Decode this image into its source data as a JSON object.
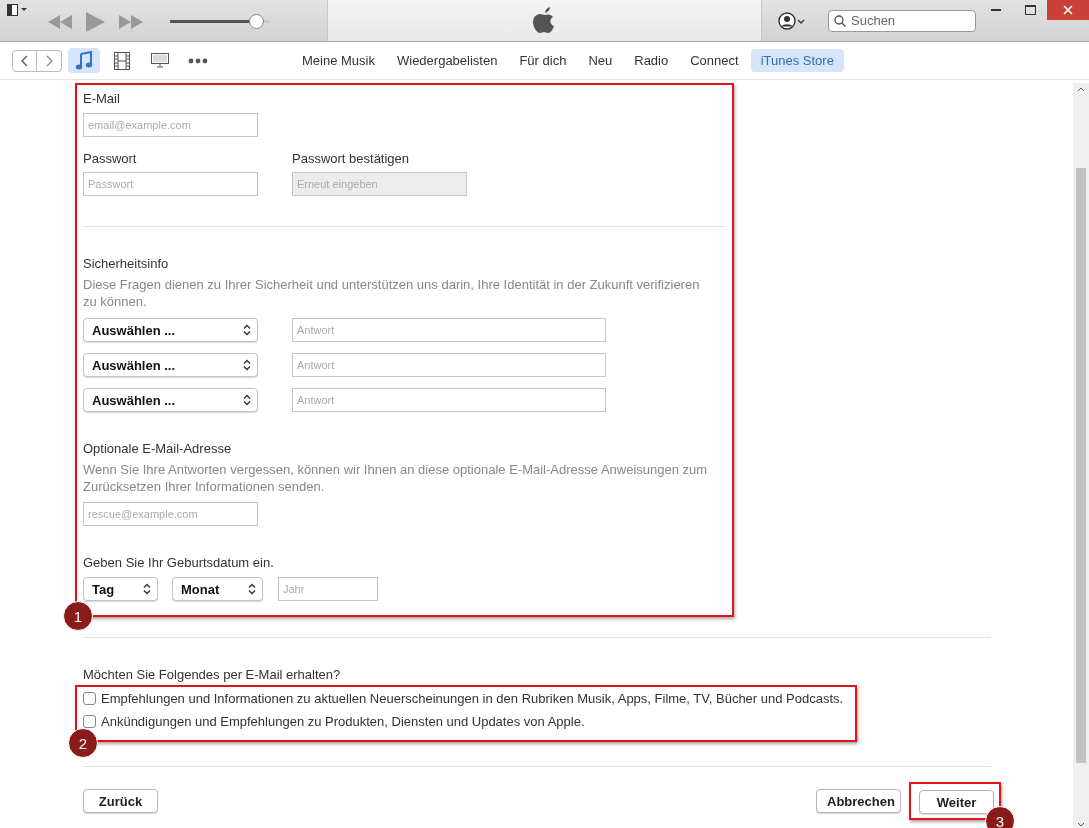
{
  "toolbar": {
    "volume": {
      "level": 0.94
    },
    "search": {
      "placeholder": "Suchen"
    }
  },
  "media_types": [
    {
      "kind": "music",
      "selected": true
    },
    {
      "kind": "film",
      "selected": false
    },
    {
      "kind": "tv",
      "selected": false
    },
    {
      "kind": "more",
      "selected": false
    }
  ],
  "nav_tabs": [
    {
      "label": "Meine Musik",
      "selected": false
    },
    {
      "label": "Wiedergabelisten",
      "selected": false
    },
    {
      "label": "Für dich",
      "selected": false
    },
    {
      "label": "Neu",
      "selected": false
    },
    {
      "label": "Radio",
      "selected": false
    },
    {
      "label": "Connect",
      "selected": false
    },
    {
      "label": "iTunes Store",
      "selected": true
    }
  ],
  "form": {
    "email": {
      "label": "E-Mail",
      "placeholder": "email@example.com"
    },
    "password": {
      "label": "Passwort",
      "placeholder": "Passwort"
    },
    "confirm": {
      "label": "Passwort bestätigen",
      "placeholder": "Erneut eingeben",
      "disabled": true
    },
    "security": {
      "title": "Sicherheitsinfo",
      "description": "Diese Fragen dienen zu Ihrer Sicherheit und unterstützen uns darin, Ihre Identität in der Zukunft verifizieren zu können.",
      "questions": [
        {
          "select": "Auswählen ...",
          "placeholder": "Antwort"
        },
        {
          "select": "Auswählen ...",
          "placeholder": "Antwort"
        },
        {
          "select": "Auswählen ...",
          "placeholder": "Antwort"
        }
      ]
    },
    "rescue": {
      "title": "Optionale E-Mail-Adresse",
      "description": "Wenn Sie Ihre Antworten vergessen, können wir Ihnen an diese optionale E-Mail-Adresse Anweisungen zum Zurücksetzen Ihrer Informationen senden.",
      "placeholder": "rescue@example.com"
    },
    "birthday": {
      "title": "Geben Sie Ihr Geburtsdatum ein.",
      "day": "Tag",
      "month": "Monat",
      "year_placeholder": "Jahr"
    }
  },
  "newsletter": {
    "question": "Möchten Sie Folgendes per E-Mail erhalten?",
    "options": [
      {
        "label": "Empfehlungen und Informationen zu aktuellen Neuerscheinungen in den Rubriken Musik, Apps, Filme, TV, Bücher und Podcasts.",
        "checked": false
      },
      {
        "label": "Ankündigungen und Empfehlungen zu Produkten, Diensten und Updates von Apple.",
        "checked": false
      }
    ]
  },
  "buttons": {
    "back": "Zurück",
    "cancel": "Abbrechen",
    "next": "Weiter"
  },
  "callouts": [
    "1",
    "2",
    "3"
  ]
}
